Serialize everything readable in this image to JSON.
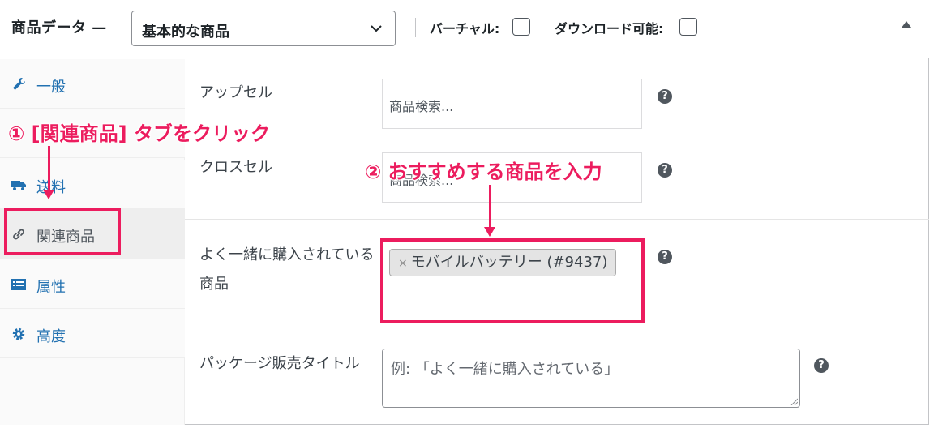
{
  "header": {
    "title": "商品データ —",
    "product_type": "基本的な商品",
    "virtual_label": "バーチャル:",
    "downloadable_label": "ダウンロード可能:"
  },
  "tabs": [
    {
      "label": "一般",
      "icon": "wrench-icon"
    },
    {
      "label": "送料",
      "icon": "truck-icon"
    },
    {
      "label": "関連商品",
      "icon": "link-icon",
      "active": true
    },
    {
      "label": "属性",
      "icon": "list-icon"
    },
    {
      "label": "高度",
      "icon": "gear-icon"
    }
  ],
  "fields": {
    "upsell_label": "アップセル",
    "upsell_placeholder": "商品検索...",
    "crosssell_label": "クロスセル",
    "crosssell_placeholder": "商品検索...",
    "bought_together_label_1": "よく一緒に購入されている",
    "bought_together_label_2": "商品",
    "bought_together_token": "モバイルバッテリー (#9437)",
    "token_remove": "×",
    "bundle_title_label": "パッケージ販売タイトル",
    "bundle_title_placeholder": "例: 「よく一緒に購入されている」",
    "help": "?"
  },
  "annotations": {
    "step1": "① [関連商品] タブをクリック",
    "step2": "② おすすめする商品を入力"
  },
  "colors": {
    "accent": "#ec1c5e",
    "link": "#2271b1"
  }
}
